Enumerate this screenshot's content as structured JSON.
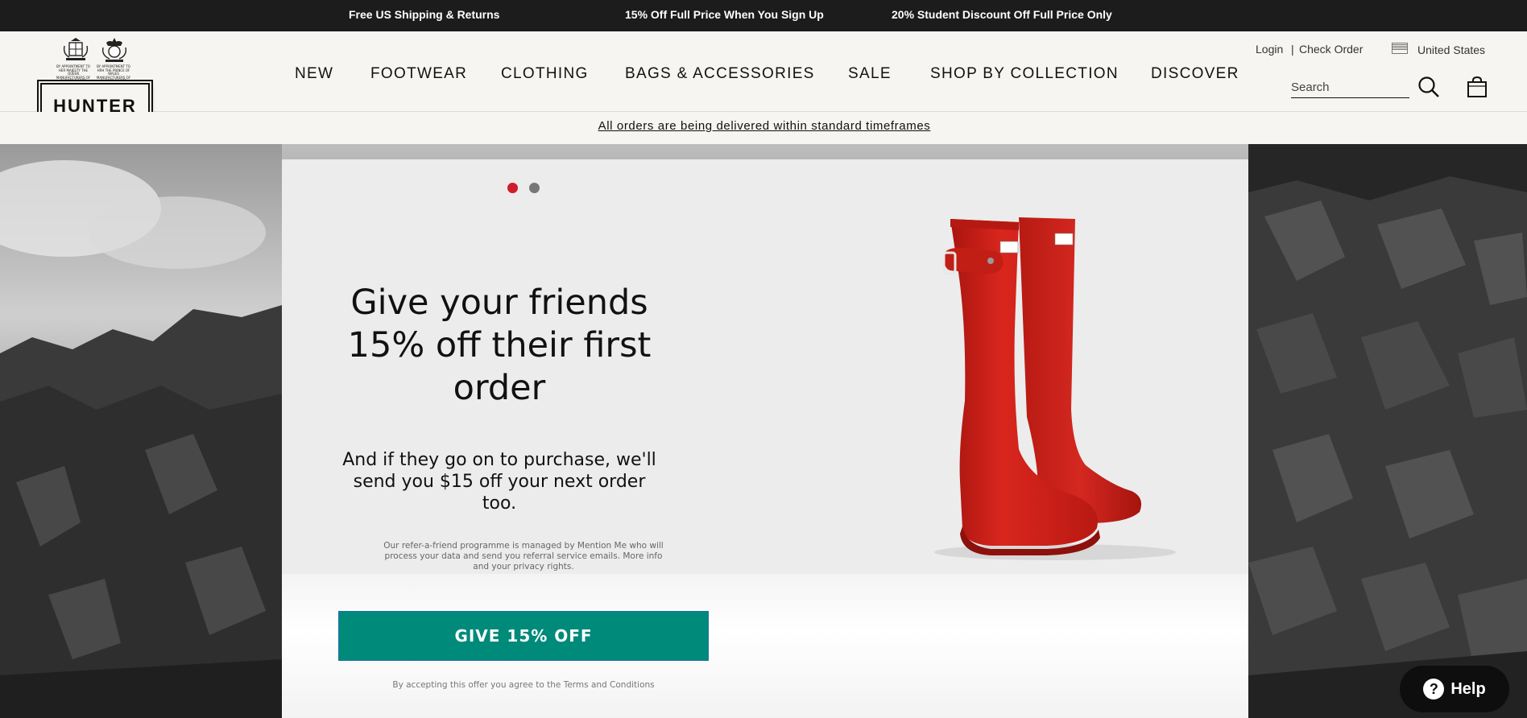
{
  "announcements": [
    "Free US Shipping & Returns",
    "15% Off Full Price When You Sign Up",
    "20% Student Discount Off Full Price Only"
  ],
  "brand": {
    "logo_text": "HUNTER",
    "crest_text_1": "BY APPOINTMENT TO HER MAJESTY THE QUEEN MANUFACTURERS OF RUBBER BOOTS",
    "crest_text_2": "BY APPOINTMENT TO HRH THE PRINCE OF WALES MANUFACTURERS OF RUBBER BOOTS"
  },
  "nav": [
    "NEW",
    "FOOTWEAR",
    "CLOTHING",
    "BAGS & ACCESSORIES",
    "SALE",
    "SHOP BY COLLECTION",
    "DISCOVER"
  ],
  "utility": {
    "login": "Login",
    "separator": "|",
    "check_order": "Check Order",
    "country": "United States"
  },
  "search": {
    "placeholder": "Search"
  },
  "notice": "All orders are being delivered within standard timeframes",
  "modal": {
    "carousel": {
      "slides": 2,
      "active": 1
    },
    "headline": "Give your friends 15% off their first order",
    "subline": "And if they go on to purchase, we'll send you $15 off your next order too.",
    "fine_print": "Our refer-a-friend programme is managed by Mention Me who will process your data and send you referral service emails. More info and your privacy rights.",
    "cta": "GIVE 15% OFF",
    "terms": "By accepting this offer you agree to the Terms and Conditions"
  },
  "help": {
    "label": "Help",
    "icon": "?"
  },
  "colors": {
    "topbar_bg": "#1c1c1c",
    "header_bg": "#f6f5f1",
    "cta_bg": "#008a7a",
    "boot_red": "#cc1f1a",
    "dot_active": "#cf1d2b",
    "dot_inactive": "#777777"
  },
  "icons": [
    "search-icon",
    "bag-icon",
    "flag-icon",
    "help-icon"
  ]
}
